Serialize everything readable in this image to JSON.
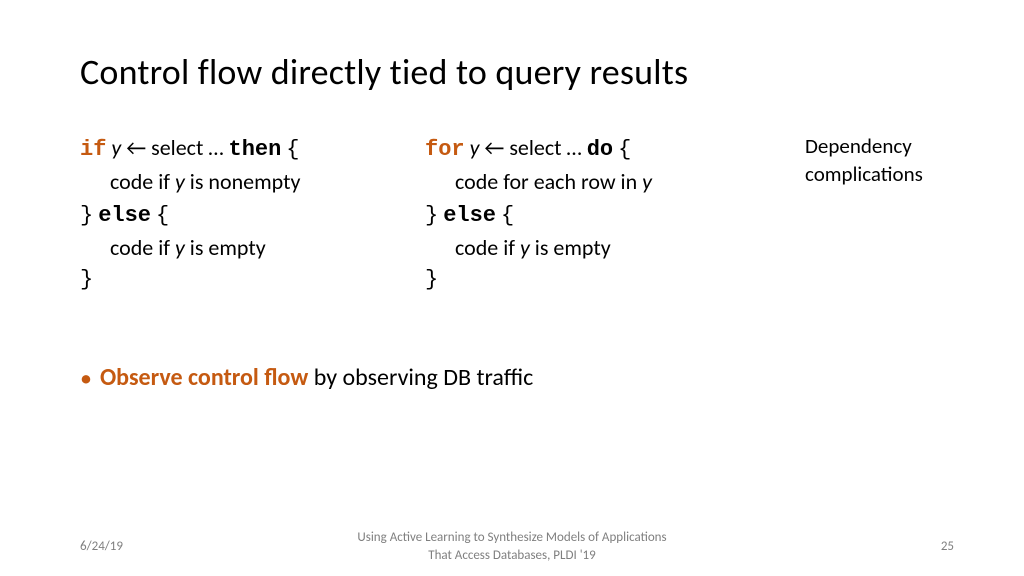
{
  "title": "Control flow directly tied to query results",
  "code_left": {
    "l1_kw1": "if",
    "l1_var": "y",
    "l1_arrow": "←",
    "l1_sel": "select …",
    "l1_kw2": "then",
    "l1_brace": "{",
    "l2": "code if",
    "l2_var": "y",
    "l2_rest": "is nonempty",
    "l3a": "}",
    "l3_kw": "else",
    "l3b": "{",
    "l4": "code if",
    "l4_var": "y",
    "l4_rest": "is empty",
    "l5": "}"
  },
  "code_right": {
    "l1_kw1": "for",
    "l1_var": "y",
    "l1_arrow": "←",
    "l1_sel": "select …",
    "l1_kw2": "do",
    "l1_brace": "{",
    "l2": "code for each row in",
    "l2_var": "y",
    "l3a": "}",
    "l3_kw": "else",
    "l3b": "{",
    "l4": "code if",
    "l4_var": "y",
    "l4_rest": "is empty",
    "l5": "}"
  },
  "side_note": {
    "line1": "Dependency",
    "line2": "complications"
  },
  "bullet": {
    "lead": "Observe control flow",
    "rest": " by observing DB traffic"
  },
  "footer": {
    "date": "6/24/19",
    "venue_l1": "Using Active Learning to Synthesize Models of Applications",
    "venue_l2": "That Access Databases, PLDI '19",
    "page": "25"
  }
}
